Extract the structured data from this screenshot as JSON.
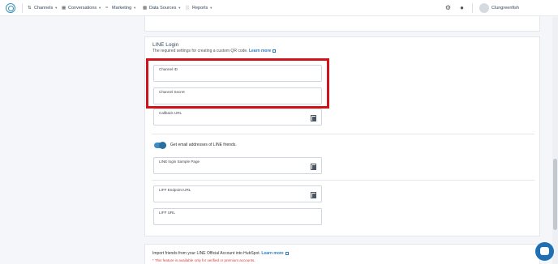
{
  "nav": {
    "items": [
      {
        "label": "Channels",
        "icon": "share-icon"
      },
      {
        "label": "Conversations",
        "icon": "chat-icon"
      },
      {
        "label": "Marketing",
        "icon": "megaphone-icon"
      },
      {
        "label": "Data Sources",
        "icon": "grid-icon"
      },
      {
        "label": "Reports",
        "icon": "bar-chart-icon"
      }
    ],
    "user_name": "Clungreenfish"
  },
  "line_login": {
    "title": "LINE Login",
    "description": "The required settings for creating a custom QR code.",
    "learn_more": "Learn more",
    "fields": {
      "channel_id": "Channel ID",
      "channel_secret": "Channel Secret",
      "callback_url": "Callback URL",
      "sample_page": "LINE login Sample Page",
      "liff_endpoint": "LIFF Endpoint URL",
      "liff_url": "LIFF URL"
    },
    "email_toggle_label": "Get email addresses of LINE friends.",
    "email_toggle_on": true
  },
  "import": {
    "text": "Import friends from your LINE Official Account into HubSpot.",
    "learn_more": "Learn more",
    "note": "* This feature is available only for verified or premium accounts."
  },
  "colors": {
    "accent": "#2d7cc0",
    "highlight": "#d0121a",
    "toggle": "#3d8ec2",
    "warning": "#d94040"
  }
}
